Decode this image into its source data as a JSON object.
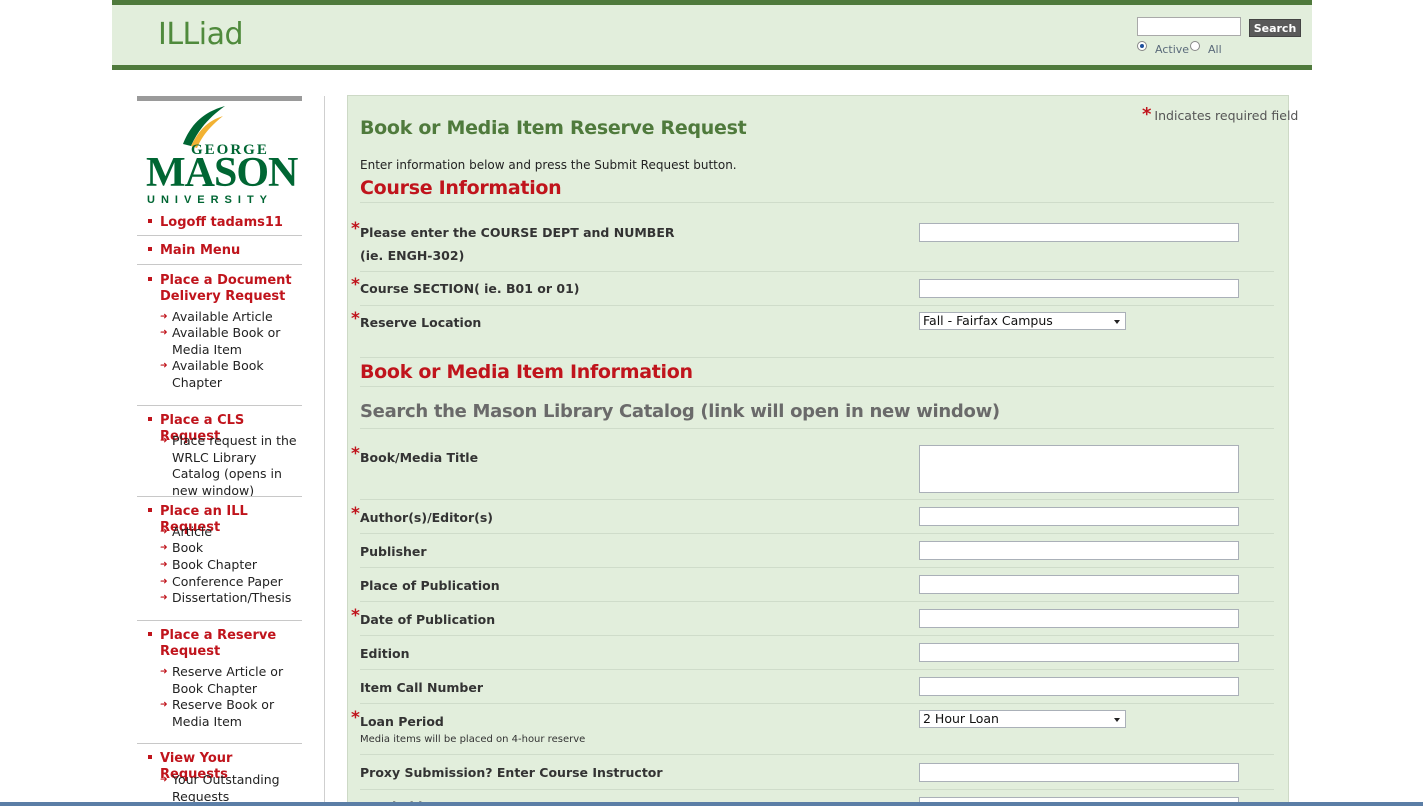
{
  "header": {
    "app_title": "ILLiad",
    "search_button": "Search",
    "search_value": "",
    "radio_active": "Active",
    "radio_all": "All"
  },
  "logo": {
    "line1": "GEORGE",
    "line2": "MASON",
    "line3": "UNIVERSITY",
    "colors": {
      "green": "#006633",
      "gold": "#f2b233"
    }
  },
  "sidebar": {
    "logoff": "Logoff tadams11",
    "main_menu": "Main Menu",
    "doc_delivery": {
      "title": "Place a Document Delivery Request",
      "items": [
        "Available Article",
        "Available Book or Media Item",
        "Available Book Chapter"
      ]
    },
    "cls": {
      "title": "Place a CLS Request",
      "items": [
        "Place request in the WRLC Library Catalog (opens in new window)"
      ]
    },
    "ill": {
      "title": "Place an ILL Request",
      "items": [
        "Article",
        "Book",
        "Book Chapter",
        "Conference Paper",
        "Dissertation/Thesis"
      ]
    },
    "reserve": {
      "title": "Place a Reserve Request",
      "items": [
        "Reserve Article or Book Chapter",
        "Reserve Book or Media Item"
      ]
    },
    "view": {
      "title": "View Your Requests",
      "items": [
        "Your Outstanding Requests"
      ]
    }
  },
  "form": {
    "required_note": "Indicates required field",
    "title": "Book or Media Item Reserve Request",
    "intro": "Enter information below and press the Submit Request button.",
    "course_section_title": "Course Information",
    "course_number_label": "Please enter the COURSE DEPT and NUMBER (ie. ENGH-302)",
    "course_section_label": "Course SECTION( ie. B01 or 01)",
    "reserve_location_label": "Reserve Location",
    "reserve_location_value": "Fall - Fairfax Campus",
    "item_section_title": "Book or Media Item Information",
    "catalog_link": "Search the Mason Library Catalog (link will open in new window)",
    "title_label": "Book/Media Title",
    "author_label": "Author(s)/Editor(s)",
    "publisher_label": "Publisher",
    "place_label": "Place of Publication",
    "date_label": "Date of Publication",
    "edition_label": "Edition",
    "call_number_label": "Item Call Number",
    "loan_period_label": "Loan Period",
    "loan_period_value": "2 Hour Loan",
    "loan_period_hint": "Media items will be placed on 4-hour reserve",
    "proxy_label": "Proxy Submission? Enter Course Instructor",
    "needed_by_label": "Needed by Date"
  },
  "colors": {
    "accent_green": "#4f7a3c",
    "panel_bg": "#e2eedc",
    "link_red": "#c0141c"
  }
}
